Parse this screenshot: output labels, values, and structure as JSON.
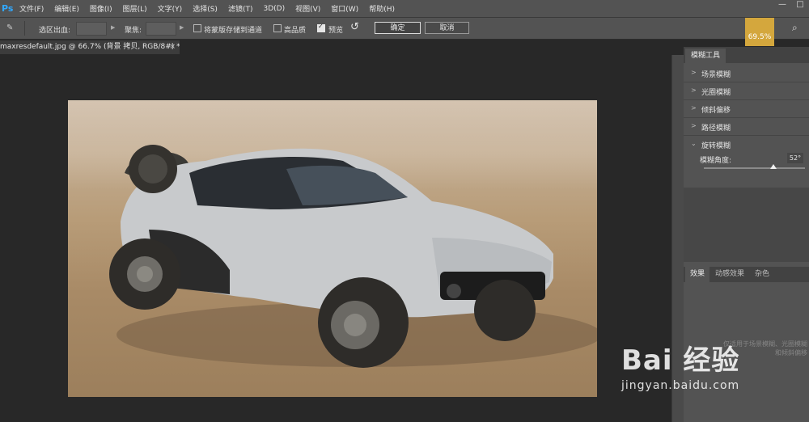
{
  "menubar": {
    "logo": "Ps",
    "items": [
      "文件(F)",
      "编辑(E)",
      "图像(I)",
      "图层(L)",
      "文字(Y)",
      "选择(S)",
      "滤镜(T)",
      "3D(D)",
      "视图(V)",
      "窗口(W)",
      "帮助(H)"
    ],
    "window_controls": [
      "—",
      "□"
    ]
  },
  "options": {
    "selection_label": "选区出血:",
    "focus_label": "聚焦:",
    "save_mask_label": "将蒙版存储到通道",
    "save_mask_checked": false,
    "high_quality_label": "高品质",
    "high_quality_checked": false,
    "preview_label": "预览",
    "preview_checked": true,
    "ok_label": "确定",
    "cancel_label": "取消",
    "progress_text": "69.5%"
  },
  "document": {
    "tab_title": "maxresdefault.jpg @ 66.7% (背景 拷贝, RGB/8#) *",
    "close_symbol": "×"
  },
  "panel": {
    "title": "模糊工具",
    "items": [
      {
        "label": "场景模糊",
        "expanded": false
      },
      {
        "label": "光圈模糊",
        "expanded": false
      },
      {
        "label": "倾斜偏移",
        "expanded": false
      },
      {
        "label": "路径模糊",
        "expanded": false
      },
      {
        "label": "旋转模糊",
        "expanded": true
      }
    ],
    "angle_label": "模糊角度:",
    "angle_value": "52°",
    "angle_fraction": 0.69,
    "bottom_tabs": [
      "效果",
      "动感效果",
      "杂色"
    ],
    "effects_note": "仅适用于场景模糊、光圈模糊和倾斜偏移"
  },
  "watermark": {
    "logo": "Bai 经验",
    "url": "jingyan.baidu.com"
  }
}
